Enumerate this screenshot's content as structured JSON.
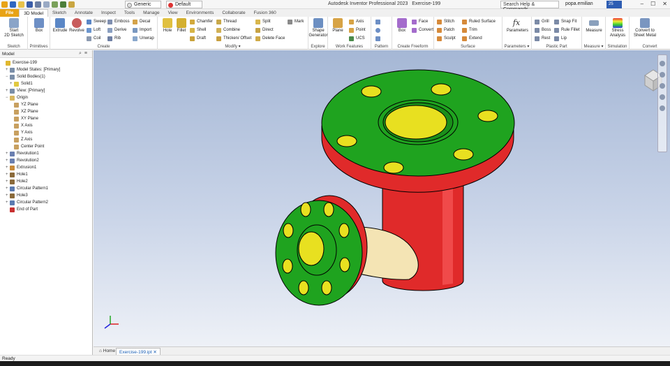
{
  "app": {
    "title": "Autodesk Inventor Professional 2023",
    "doc": "Exercise-199"
  },
  "quick_access": {
    "material": "Generic",
    "appearance": "Default"
  },
  "search": {
    "placeholder": "Search Help & Commands..."
  },
  "user": {
    "name": "popa.emilian",
    "badge": "25"
  },
  "tabs": [
    "File",
    "3D Model",
    "Sketch",
    "Annotate",
    "Inspect",
    "Tools",
    "Manage",
    "View",
    "Environments",
    "Collaborate",
    "Fusion 360"
  ],
  "ribbon": {
    "sketch": {
      "group": "Sketch",
      "start": "Start\n2D Sketch"
    },
    "primitives": {
      "group": "Primitives",
      "box": "Box"
    },
    "create": {
      "group": "Create",
      "extrude": "Extrude",
      "revolve": "Revolve",
      "sweep": "Sweep",
      "loft": "Loft",
      "coil": "Coil",
      "emboss": "Emboss",
      "derive": "Derive",
      "rib": "Rib",
      "decal": "Decal",
      "import": "Import",
      "unwrap": "Unwrap"
    },
    "modify": {
      "group": "Modify ▾",
      "hole": "Hole",
      "fillet": "Fillet",
      "chamfer": "Chamfer",
      "shell": "Shell",
      "draft": "Draft",
      "thread": "Thread",
      "combine": "Combine",
      "thicken": "Thicken/ Offset",
      "split": "Split",
      "direct": "Direct",
      "delete_face": "Delete Face",
      "mark": "Mark"
    },
    "explore": {
      "group": "Explore",
      "shape": "Shape\nGenerator"
    },
    "work": {
      "group": "Work Features",
      "plane": "Plane",
      "axis": "Axis",
      "point": "Point",
      "ucs": "UCS"
    },
    "pattern": {
      "group": "Pattern"
    },
    "freeform": {
      "group": "Create Freeform",
      "box": "Box",
      "face": "Face",
      "convert": "Convert"
    },
    "surface": {
      "group": "Surface",
      "stitch": "Stitch",
      "patch": "Patch",
      "sculpt": "Sculpt",
      "ruled": "Ruled Surface",
      "trim": "Trim",
      "extend": "Extend"
    },
    "parameters": {
      "group": "Parameters ▾",
      "label": "Parameters"
    },
    "plastic": {
      "group": "Plastic Part",
      "grill": "Grill",
      "boss": "Boss",
      "rest": "Rest",
      "snap": "Snap Fit",
      "rule_fillet": "Rule Fillet",
      "lip": "Lip"
    },
    "measure": {
      "group": "Measure ▾",
      "label": "Measure"
    },
    "simulation": {
      "group": "Simulation",
      "label": "Stress\nAnalysis"
    },
    "convert": {
      "group": "Convert",
      "label": "Convert to\nSheet Metal"
    }
  },
  "browser": {
    "tab": "Model",
    "items": [
      {
        "label": "Exercise-199",
        "indent": 0,
        "pm": "",
        "color": "#e0b830"
      },
      {
        "label": "Model States: [Primary]",
        "indent": 1,
        "pm": "+",
        "color": "#7a8ea8"
      },
      {
        "label": "Solid Bodies(1)",
        "indent": 1,
        "pm": "−",
        "color": "#7a8ea8"
      },
      {
        "label": "Solid1",
        "indent": 2,
        "pm": "+",
        "color": "#e0c840"
      },
      {
        "label": "View: [Primary]",
        "indent": 1,
        "pm": "+",
        "color": "#7a8ea8"
      },
      {
        "label": "Origin",
        "indent": 1,
        "pm": "−",
        "color": "#d8b860"
      },
      {
        "label": "YZ Plane",
        "indent": 2,
        "pm": "",
        "color": "#c8a060"
      },
      {
        "label": "XZ Plane",
        "indent": 2,
        "pm": "",
        "color": "#c8a060"
      },
      {
        "label": "XY Plane",
        "indent": 2,
        "pm": "",
        "color": "#c8a060"
      },
      {
        "label": "X Axis",
        "indent": 2,
        "pm": "",
        "color": "#c8a060"
      },
      {
        "label": "Y Axis",
        "indent": 2,
        "pm": "",
        "color": "#c8a060"
      },
      {
        "label": "Z Axis",
        "indent": 2,
        "pm": "",
        "color": "#c8a060"
      },
      {
        "label": "Center Point",
        "indent": 2,
        "pm": "",
        "color": "#c8a060"
      },
      {
        "label": "Revolution1",
        "indent": 1,
        "pm": "+",
        "color": "#6a7fb0"
      },
      {
        "label": "Revolution2",
        "indent": 1,
        "pm": "+",
        "color": "#6a7fb0"
      },
      {
        "label": "Extrusion1",
        "indent": 1,
        "pm": "+",
        "color": "#c88a3a"
      },
      {
        "label": "Hole1",
        "indent": 1,
        "pm": "+",
        "color": "#8a6a3a"
      },
      {
        "label": "Hole2",
        "indent": 1,
        "pm": "+",
        "color": "#8a6a3a"
      },
      {
        "label": "Circular Pattern1",
        "indent": 1,
        "pm": "+",
        "color": "#5a7ab0"
      },
      {
        "label": "Hole3",
        "indent": 1,
        "pm": "+",
        "color": "#8a6a3a"
      },
      {
        "label": "Circular Pattern2",
        "indent": 1,
        "pm": "+",
        "color": "#5a7ab0"
      },
      {
        "label": "End of Part",
        "indent": 1,
        "pm": "",
        "color": "#c83030"
      }
    ]
  },
  "doc_tabs": {
    "home": "Home",
    "file": "Exercise-199.ipt"
  },
  "status": {
    "text": "Ready"
  },
  "colors": {
    "flange": "#1fa31f",
    "pipe": "#e02a2a",
    "face": "#e8e020",
    "elbow": "#f4e4b4",
    "file_tab": "#e8a316"
  }
}
